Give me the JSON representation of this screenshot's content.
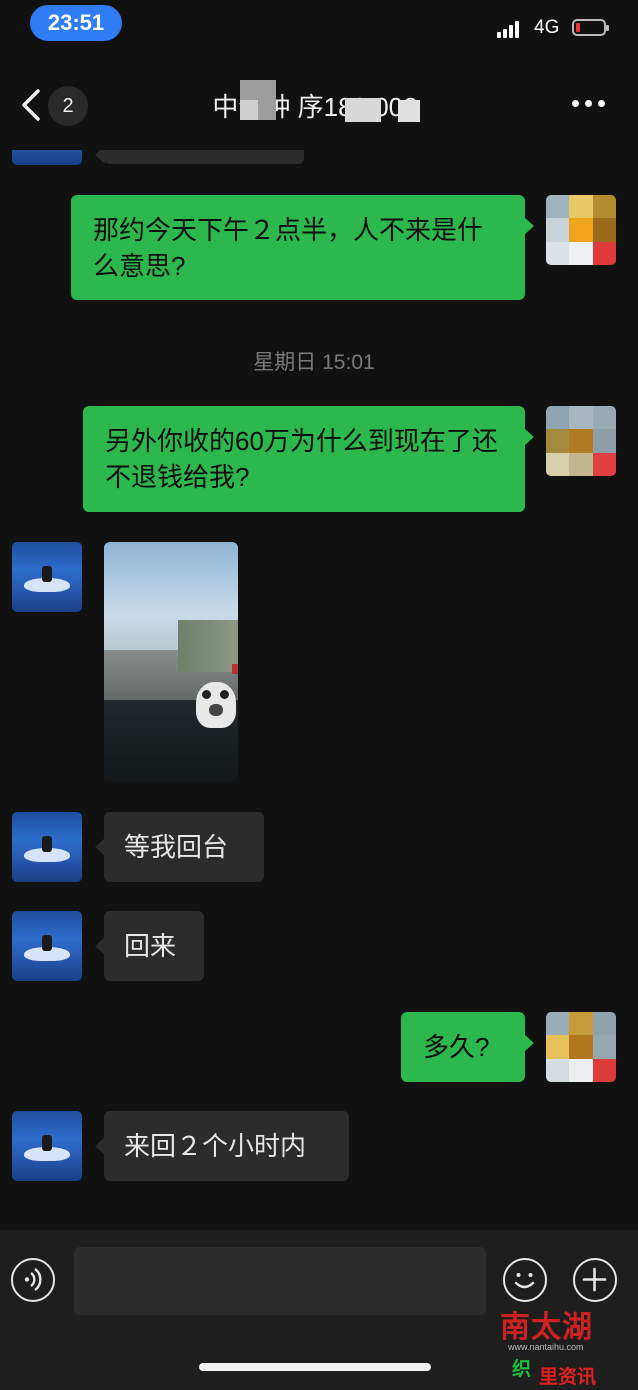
{
  "status_bar": {
    "time": "23:51",
    "network": "4G"
  },
  "nav": {
    "back_count": "2",
    "title": "中介钟   ‍序183      002"
  },
  "messages": {
    "m1": "那约今天下午２点半，人不来是什么意思?",
    "timestamp": "星期日 15:01",
    "m2": "另外你收的60万为什么到现在了还不退钱给我?",
    "m3": "等我回台",
    "m4": "回来",
    "m5": "多久?",
    "m6": "来回２个小时内"
  },
  "watermark": {
    "logo": "南太湖",
    "url": "www.nantaihu.com",
    "sub1": "织",
    "sub2": "里资讯"
  },
  "colors": {
    "outgoing_bubble": "#2db84d",
    "incoming_bubble": "#2c2c2c",
    "background": "#111111",
    "time_pill": "#2f7cf6"
  },
  "icons": [
    "chevron-left-icon",
    "more-icon",
    "voice-icon",
    "emoji-icon",
    "plus-icon",
    "signal-icon",
    "battery-icon"
  ]
}
